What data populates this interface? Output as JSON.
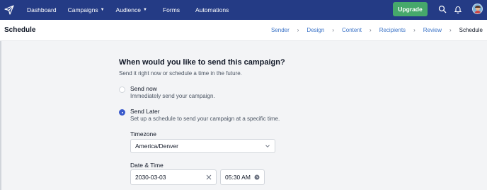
{
  "nav": {
    "logo_icon": "paper-plane-icon",
    "items": [
      {
        "label": "Dashboard",
        "has_dropdown": false
      },
      {
        "label": "Campaigns",
        "has_dropdown": true
      },
      {
        "label": "Audience",
        "has_dropdown": true
      },
      {
        "label": "Forms",
        "has_dropdown": false
      },
      {
        "label": "Automations",
        "has_dropdown": false
      }
    ],
    "upgrade_label": "Upgrade",
    "icons": [
      "search-icon",
      "bell-icon",
      "avatar"
    ],
    "colors": {
      "bar": "#243b85",
      "upgrade": "#46a86b"
    }
  },
  "header": {
    "title": "Schedule",
    "breadcrumbs": [
      "Sender",
      "Design",
      "Content",
      "Recipients",
      "Review",
      "Schedule"
    ],
    "current_step": "Schedule"
  },
  "schedule": {
    "question": "When would you like to send this campaign?",
    "subtitle": "Send it right now or schedule a time in the future.",
    "options": [
      {
        "label": "Send now",
        "description": "Immediately send your campaign.",
        "selected": false
      },
      {
        "label": "Send Later",
        "description": "Set up a schedule to send your campaign at a specific time.",
        "selected": true
      }
    ],
    "timezone_label": "Timezone",
    "timezone_value": "America/Denver",
    "datetime_label": "Date & Time",
    "date_value": "2030-03-03",
    "time_value": "05:30 AM",
    "accent": "#3b5bcc"
  }
}
